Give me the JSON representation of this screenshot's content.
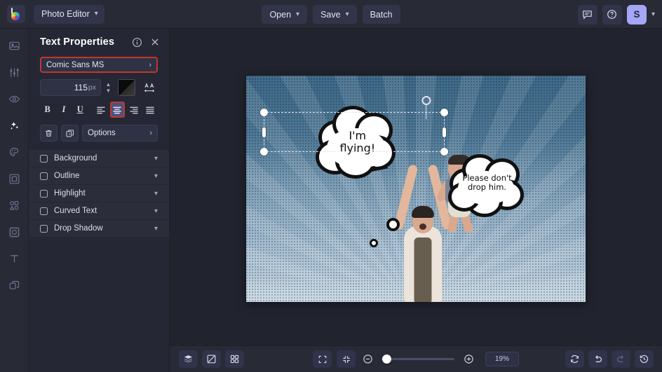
{
  "app": {
    "logo_name": "photo-editor-logo",
    "menu_label": "Photo Editor"
  },
  "topbar": {
    "open_label": "Open",
    "save_label": "Save",
    "batch_label": "Batch",
    "feedback_icon": "chat-bubble-icon",
    "help_icon": "help-circle-icon",
    "avatar_initial": "S",
    "avatar_color": "#a5a6f6"
  },
  "rail": {
    "items": [
      {
        "name": "sidebar-item-image",
        "icon": "image-icon",
        "active": false
      },
      {
        "name": "sidebar-item-adjust",
        "icon": "sliders-icon",
        "active": false
      },
      {
        "name": "sidebar-item-effects",
        "icon": "eye-icon",
        "active": false
      },
      {
        "name": "sidebar-item-ai",
        "icon": "sparkles-icon",
        "active": true
      },
      {
        "name": "sidebar-item-paint",
        "icon": "palette-icon",
        "active": false
      },
      {
        "name": "sidebar-item-frames",
        "icon": "frame-icon",
        "active": false
      },
      {
        "name": "sidebar-item-shapes",
        "icon": "shapes-icon",
        "active": false
      },
      {
        "name": "sidebar-item-overlays",
        "icon": "overlay-icon",
        "active": false
      },
      {
        "name": "sidebar-item-text",
        "icon": "text-t-icon",
        "active": false
      },
      {
        "name": "sidebar-item-layers",
        "icon": "layers-icon",
        "active": false
      }
    ]
  },
  "panel": {
    "title": "Text Properties",
    "info_icon": "info-circle-icon",
    "close_icon": "close-icon",
    "font": {
      "value": "Comic Sans MS",
      "chevron": "chevron-right-icon",
      "highlight_color": "#c0392b"
    },
    "size": {
      "value": "115",
      "unit": "px"
    },
    "color_swatch": "#000000",
    "spacing_icon": "letter-spacing-icon",
    "format": {
      "bold": "B",
      "italic": "I",
      "underline": "U",
      "align_left": "align-left-icon",
      "align_center": "align-center-icon",
      "align_right": "align-right-icon",
      "align_justify": "align-justify-icon",
      "selected_align": "center"
    },
    "actions": {
      "delete_icon": "trash-icon",
      "duplicate_icon": "duplicate-icon",
      "options_label": "Options",
      "options_chevron": "chevron-right-icon"
    },
    "options": [
      {
        "label": "Background",
        "checked": false,
        "name": "option-background"
      },
      {
        "label": "Outline",
        "checked": false,
        "name": "option-outline"
      },
      {
        "label": "Highlight",
        "checked": false,
        "name": "option-highlight"
      },
      {
        "label": "Curved Text",
        "checked": false,
        "name": "option-curved-text"
      },
      {
        "label": "Drop Shadow",
        "checked": false,
        "name": "option-drop-shadow"
      }
    ]
  },
  "canvas": {
    "speech_bubble_text": "I'm\nflying!",
    "thought_bubble_text": "Please don't\ndrop him.",
    "selection": "text-selection-box"
  },
  "bottombar": {
    "layers_icon": "layers-stack-icon",
    "compare_icon": "compare-split-icon",
    "grid_icon": "grid-view-icon",
    "fit_icon": "fit-to-screen-icon",
    "actual_icon": "actual-size-icon",
    "zoom_out_icon": "zoom-out-icon",
    "zoom_in_icon": "zoom-in-icon",
    "zoom_level": "19%",
    "zoom_slider_percent": 9,
    "reset_icon": "reset-icon",
    "undo_icon": "undo-icon",
    "redo_icon": "redo-icon",
    "history_icon": "history-icon"
  }
}
